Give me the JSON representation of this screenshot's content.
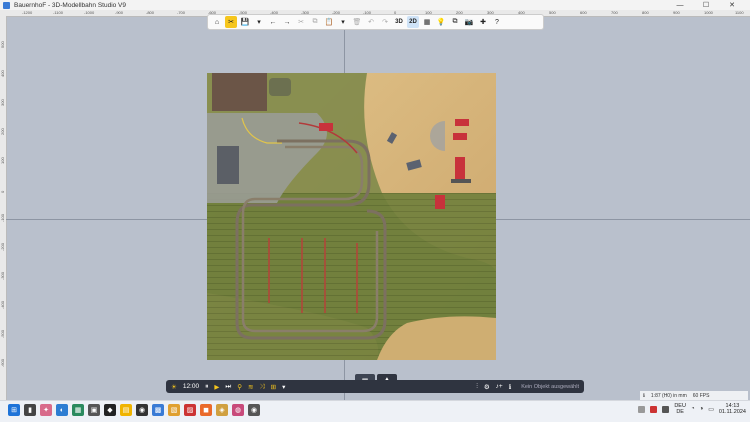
{
  "window": {
    "title": "BauernhoF - 3D-Modellbahn Studio V9",
    "minimize": "—",
    "maximize": "☐",
    "close": "✕"
  },
  "ruler": {
    "top_ticks": [
      "-1200",
      "-1100",
      "-1000",
      "-900",
      "-800",
      "-700",
      "-600",
      "-500",
      "-400",
      "-300",
      "-200",
      "-100",
      "0",
      "100",
      "200",
      "300",
      "400",
      "500",
      "600",
      "700",
      "800",
      "900",
      "1000",
      "1100"
    ],
    "left_ticks": [
      "500",
      "400",
      "300",
      "200",
      "100",
      "0",
      "-100",
      "-200",
      "-300",
      "-400",
      "-500",
      "-600"
    ]
  },
  "toolbar": {
    "home": "⌂",
    "tools": "✂",
    "save": "💾",
    "save_arrow": "▾",
    "back": "←",
    "forward": "→",
    "cut": "✂",
    "copy": "⧉",
    "paste": "📋",
    "paste_arrow": "▾",
    "delete": "🗑",
    "undo": "↶",
    "redo": "↷",
    "view_3d": "3D",
    "view_2d": "2D",
    "grid": "▦",
    "light": "💡",
    "windows": "⧉",
    "camera": "📷",
    "plugins": "✚",
    "help": "?"
  },
  "viewtabs": {
    "layout": "▦",
    "terrain": "⛰"
  },
  "bottombar": {
    "sun": "☀",
    "time": "12:00",
    "pause": "⏸",
    "play": "▶",
    "skip": "⏭",
    "search": "⚲",
    "layers": "≋",
    "shuffle": "⤨",
    "tracks": "⊞",
    "tracks_arrow": "▾",
    "sliders": "⫶",
    "settings": "⚙",
    "addtrack": "♪+",
    "info": "ℹ",
    "status": "Kein Objekt ausgewählt"
  },
  "infobar": {
    "icon": "ℹ",
    "scale": "1:87 (H0) in mm",
    "fps": "60 FPS"
  },
  "taskbar": {
    "icons": [
      "⊞",
      "▮",
      "✦",
      "◐",
      "▦",
      "▣",
      "◆",
      "▤",
      "◉",
      "▩",
      "▧",
      "▨",
      "◼",
      "◈",
      "◍",
      "◉"
    ],
    "lang1": "DEU",
    "lang2": "DE",
    "time": "14:13",
    "date": "01.11.2024"
  },
  "colors": {
    "accent": "#f6c61d",
    "bottombar": "#2f3440",
    "grass": "#6e7d3a",
    "field": "#d9b77c",
    "asphalt": "#8a8f8c"
  }
}
